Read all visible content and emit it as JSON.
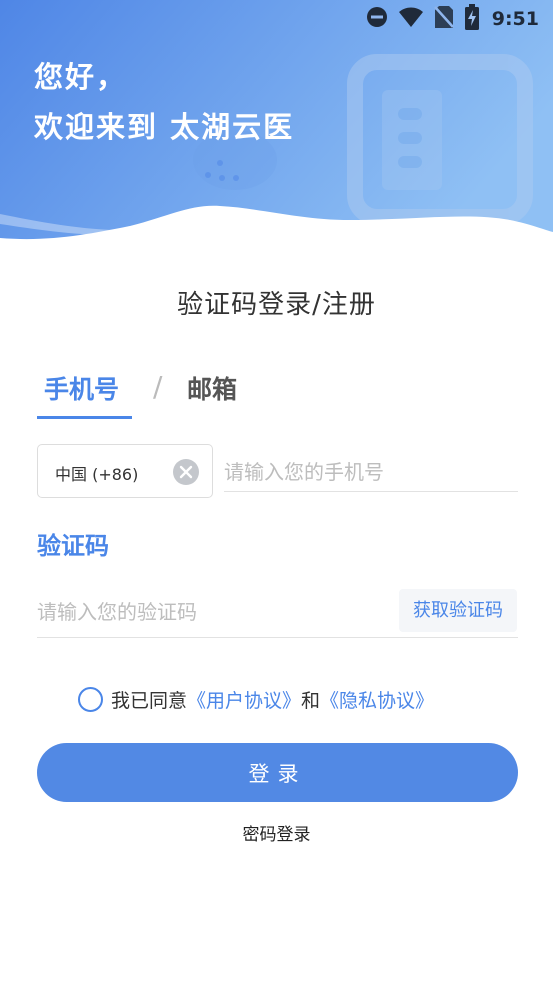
{
  "status_bar": {
    "time": "9:51",
    "icons": [
      "do-not-disturb-icon",
      "wifi-icon",
      "no-sim-icon",
      "battery-charging-icon"
    ]
  },
  "header": {
    "greeting_line1": "您好，",
    "greeting_line2": "欢迎来到 太湖云医"
  },
  "page_title": "验证码登录/注册",
  "tabs": {
    "phone": "手机号",
    "divider": "/",
    "email": "邮箱"
  },
  "phone_form": {
    "country_code": "中国 (+86)",
    "phone_placeholder": "请输入您的手机号"
  },
  "code_form": {
    "title": "验证码",
    "code_placeholder": "请输入您的验证码",
    "get_code_label": "获取验证码"
  },
  "agreement": {
    "prefix": "我已同意",
    "user_agreement": "《用户协议》",
    "and": "和",
    "privacy_policy": "《隐私协议》"
  },
  "login_button": "登录",
  "password_login": "密码登录",
  "colors": {
    "accent": "#4a86e8",
    "button": "#5289e4",
    "hero_start": "#4f86e6",
    "hero_end": "#86b9f2"
  }
}
